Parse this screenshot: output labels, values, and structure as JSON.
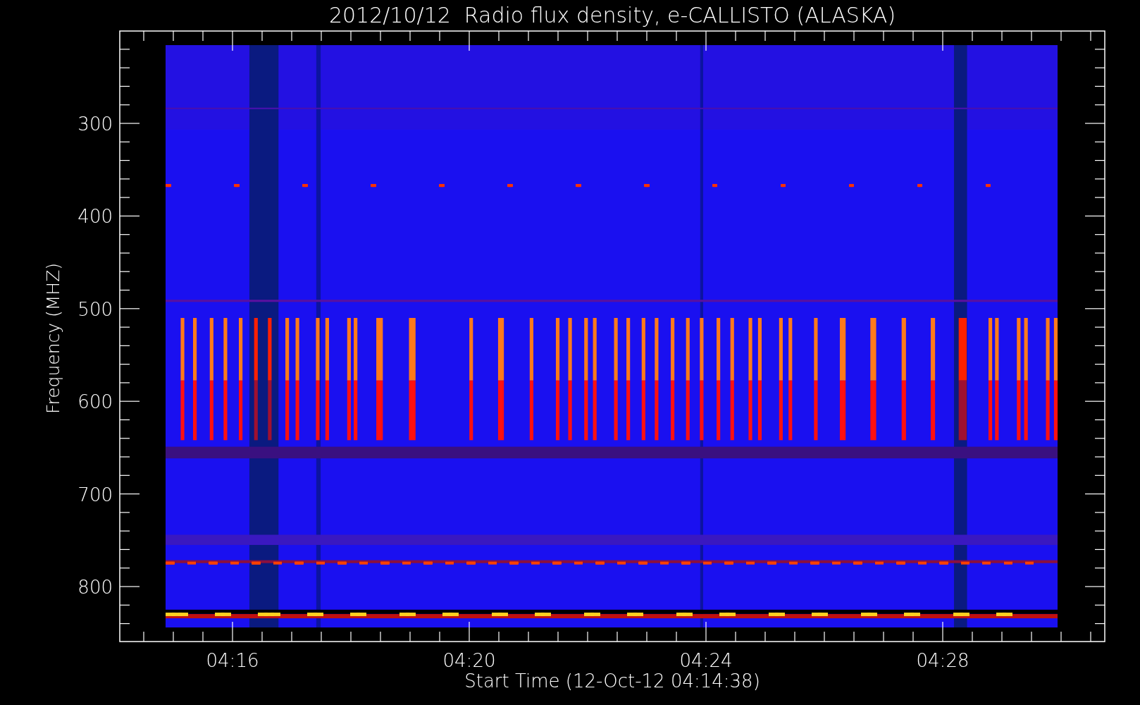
{
  "title": "2012/10/12  Radio flux density, e-CALLISTO (ALASKA)",
  "y_axis": {
    "label": "Frequency (MHZ)",
    "ticks": [
      "300",
      "400",
      "500",
      "600",
      "700",
      "800"
    ]
  },
  "x_axis": {
    "label": "Start Time (12-Oct-12 04:14:38)",
    "ticks": [
      "04:16",
      "04:20",
      "04:24",
      "04:28"
    ]
  }
}
